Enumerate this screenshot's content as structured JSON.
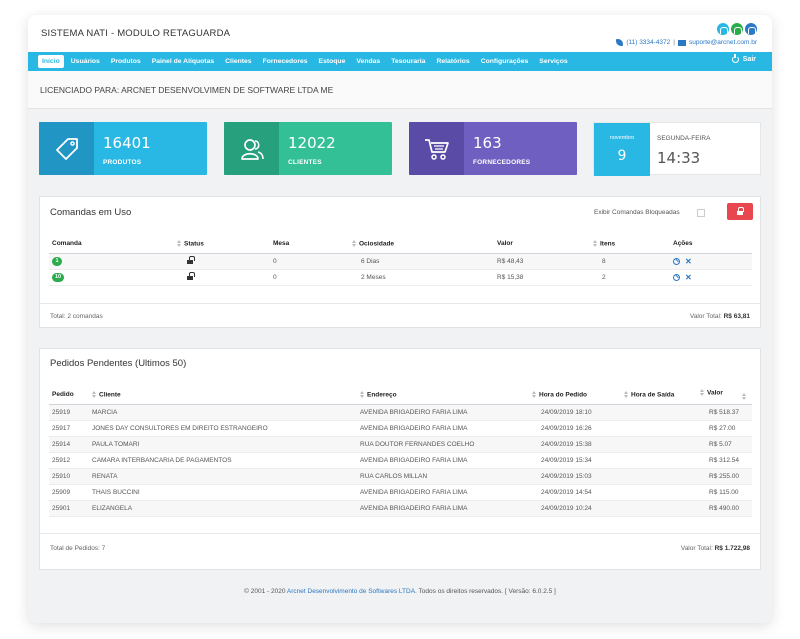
{
  "app": {
    "title": "SISTEMA NATI - MODULO RETAGUARDA",
    "phone": "(11) 3334-4372",
    "separator": "|",
    "email": "suporte@arcnet.com.br",
    "logo_colors": [
      "#29b8e3",
      "#2aab4c",
      "#2b78c5"
    ]
  },
  "nav": {
    "items": [
      "Início",
      "Usuários",
      "Produtos",
      "Painel de Alíquotas",
      "Clientes",
      "Fornecedores",
      "Estoque",
      "Vendas",
      "Tesouraria",
      "Relatórios",
      "Configurações",
      "Serviços"
    ],
    "active_index": 0,
    "logout_label": "Sair",
    "color": "#29b8e3"
  },
  "license": {
    "text": "LICENCIADO PARA: ARCNET DESENVOLVIMEN DE SOFTWARE LTDA ME"
  },
  "stats": [
    {
      "value": "16401",
      "label": "PRODUTOS",
      "icon": "tag-icon",
      "color": "#29b8e3",
      "dark": "#2196c4"
    },
    {
      "value": "12022",
      "label": "CLIENTES",
      "icon": "users-icon",
      "color": "#33c097",
      "dark": "#27a07e"
    },
    {
      "value": "163",
      "label": "FORNECEDORES",
      "icon": "cart-icon",
      "color": "#6e5fc0",
      "dark": "#5a4ca6"
    }
  ],
  "date": {
    "month": "novembro",
    "day": "9",
    "weekday": "SEGUNDA-FEIRA",
    "time": "14:33"
  },
  "comandas": {
    "title": "Comandas em Uso",
    "blocked_label": "Exibir Comandas Bloqueadas",
    "headers": [
      "Comanda",
      "Status",
      "Mesa",
      "Ociosidade",
      "Valor",
      "Itens",
      "Ações"
    ],
    "rows": [
      {
        "comanda": "1",
        "mesa": "0",
        "ociosidade": "6 Dias",
        "valor": "R$ 48,43",
        "itens": "8"
      },
      {
        "comanda": "10",
        "mesa": "0",
        "ociosidade": "2 Meses",
        "valor": "R$ 15,38",
        "itens": "2"
      }
    ],
    "footer_left": "Total: 2 comandas",
    "footer_right_label": "Valor Total:",
    "footer_right_value": "R$ 63,81"
  },
  "pedidos": {
    "title": "Pedidos Pendentes (Ultimos 50)",
    "headers": [
      "Pedido",
      "Cliente",
      "Endereço",
      "Hora do Pedido",
      "Hora de Saída",
      "Valor"
    ],
    "rows": [
      {
        "pedido": "25919",
        "cliente": "MARCIA",
        "endereco": "AVENIDA BRIGADEIRO FARIA LIMA",
        "hora_pedido": "24/09/2019 18:10",
        "hora_saida": "",
        "valor": "R$ 518.37"
      },
      {
        "pedido": "25917",
        "cliente": "JONES DAY CONSULTORES EM DIREITO ESTRANGEIRO",
        "endereco": "AVENIDA BRIGADEIRO FARIA LIMA",
        "hora_pedido": "24/09/2019 16:26",
        "hora_saida": "",
        "valor": "R$ 27.00"
      },
      {
        "pedido": "25914",
        "cliente": "PAULA TOMARI",
        "endereco": "RUA DOUTOR FERNANDES COELHO",
        "hora_pedido": "24/09/2019 15:38",
        "hora_saida": "",
        "valor": "R$ 5.07"
      },
      {
        "pedido": "25912",
        "cliente": "CAMARA INTERBANCARIA DE PAGAMENTOS",
        "endereco": "AVENIDA BRIGADEIRO FARIA LIMA",
        "hora_pedido": "24/09/2019 15:34",
        "hora_saida": "",
        "valor": "R$ 312.54"
      },
      {
        "pedido": "25910",
        "cliente": "RENATA",
        "endereco": "RUA CARLOS MILLAN",
        "hora_pedido": "24/09/2019 15:03",
        "hora_saida": "",
        "valor": "R$ 255.00"
      },
      {
        "pedido": "25909",
        "cliente": "THAIS BUCCINI",
        "endereco": "AVENIDA BRIGADEIRO FARIA LIMA",
        "hora_pedido": "24/09/2019 14:54",
        "hora_saida": "",
        "valor": "R$ 115.00"
      },
      {
        "pedido": "25901",
        "cliente": "ELIZANGELA",
        "endereco": "AVENIDA BRIGADEIRO FARIA LIMA",
        "hora_pedido": "24/09/2019 10:24",
        "hora_saida": "",
        "valor": "R$ 490.00"
      }
    ],
    "footer_left": "Total de Pedidos: 7",
    "footer_right_label": "Valor Total:",
    "footer_right_value": "R$ 1.722,98"
  },
  "footer": {
    "prefix": "© 2001 - 2020",
    "company": "Arcnet Desenvolvimento de Softwares LTDA.",
    "suffix": "Todos os direitos reservados. [ Versão: 6.0.2.5 ]"
  }
}
